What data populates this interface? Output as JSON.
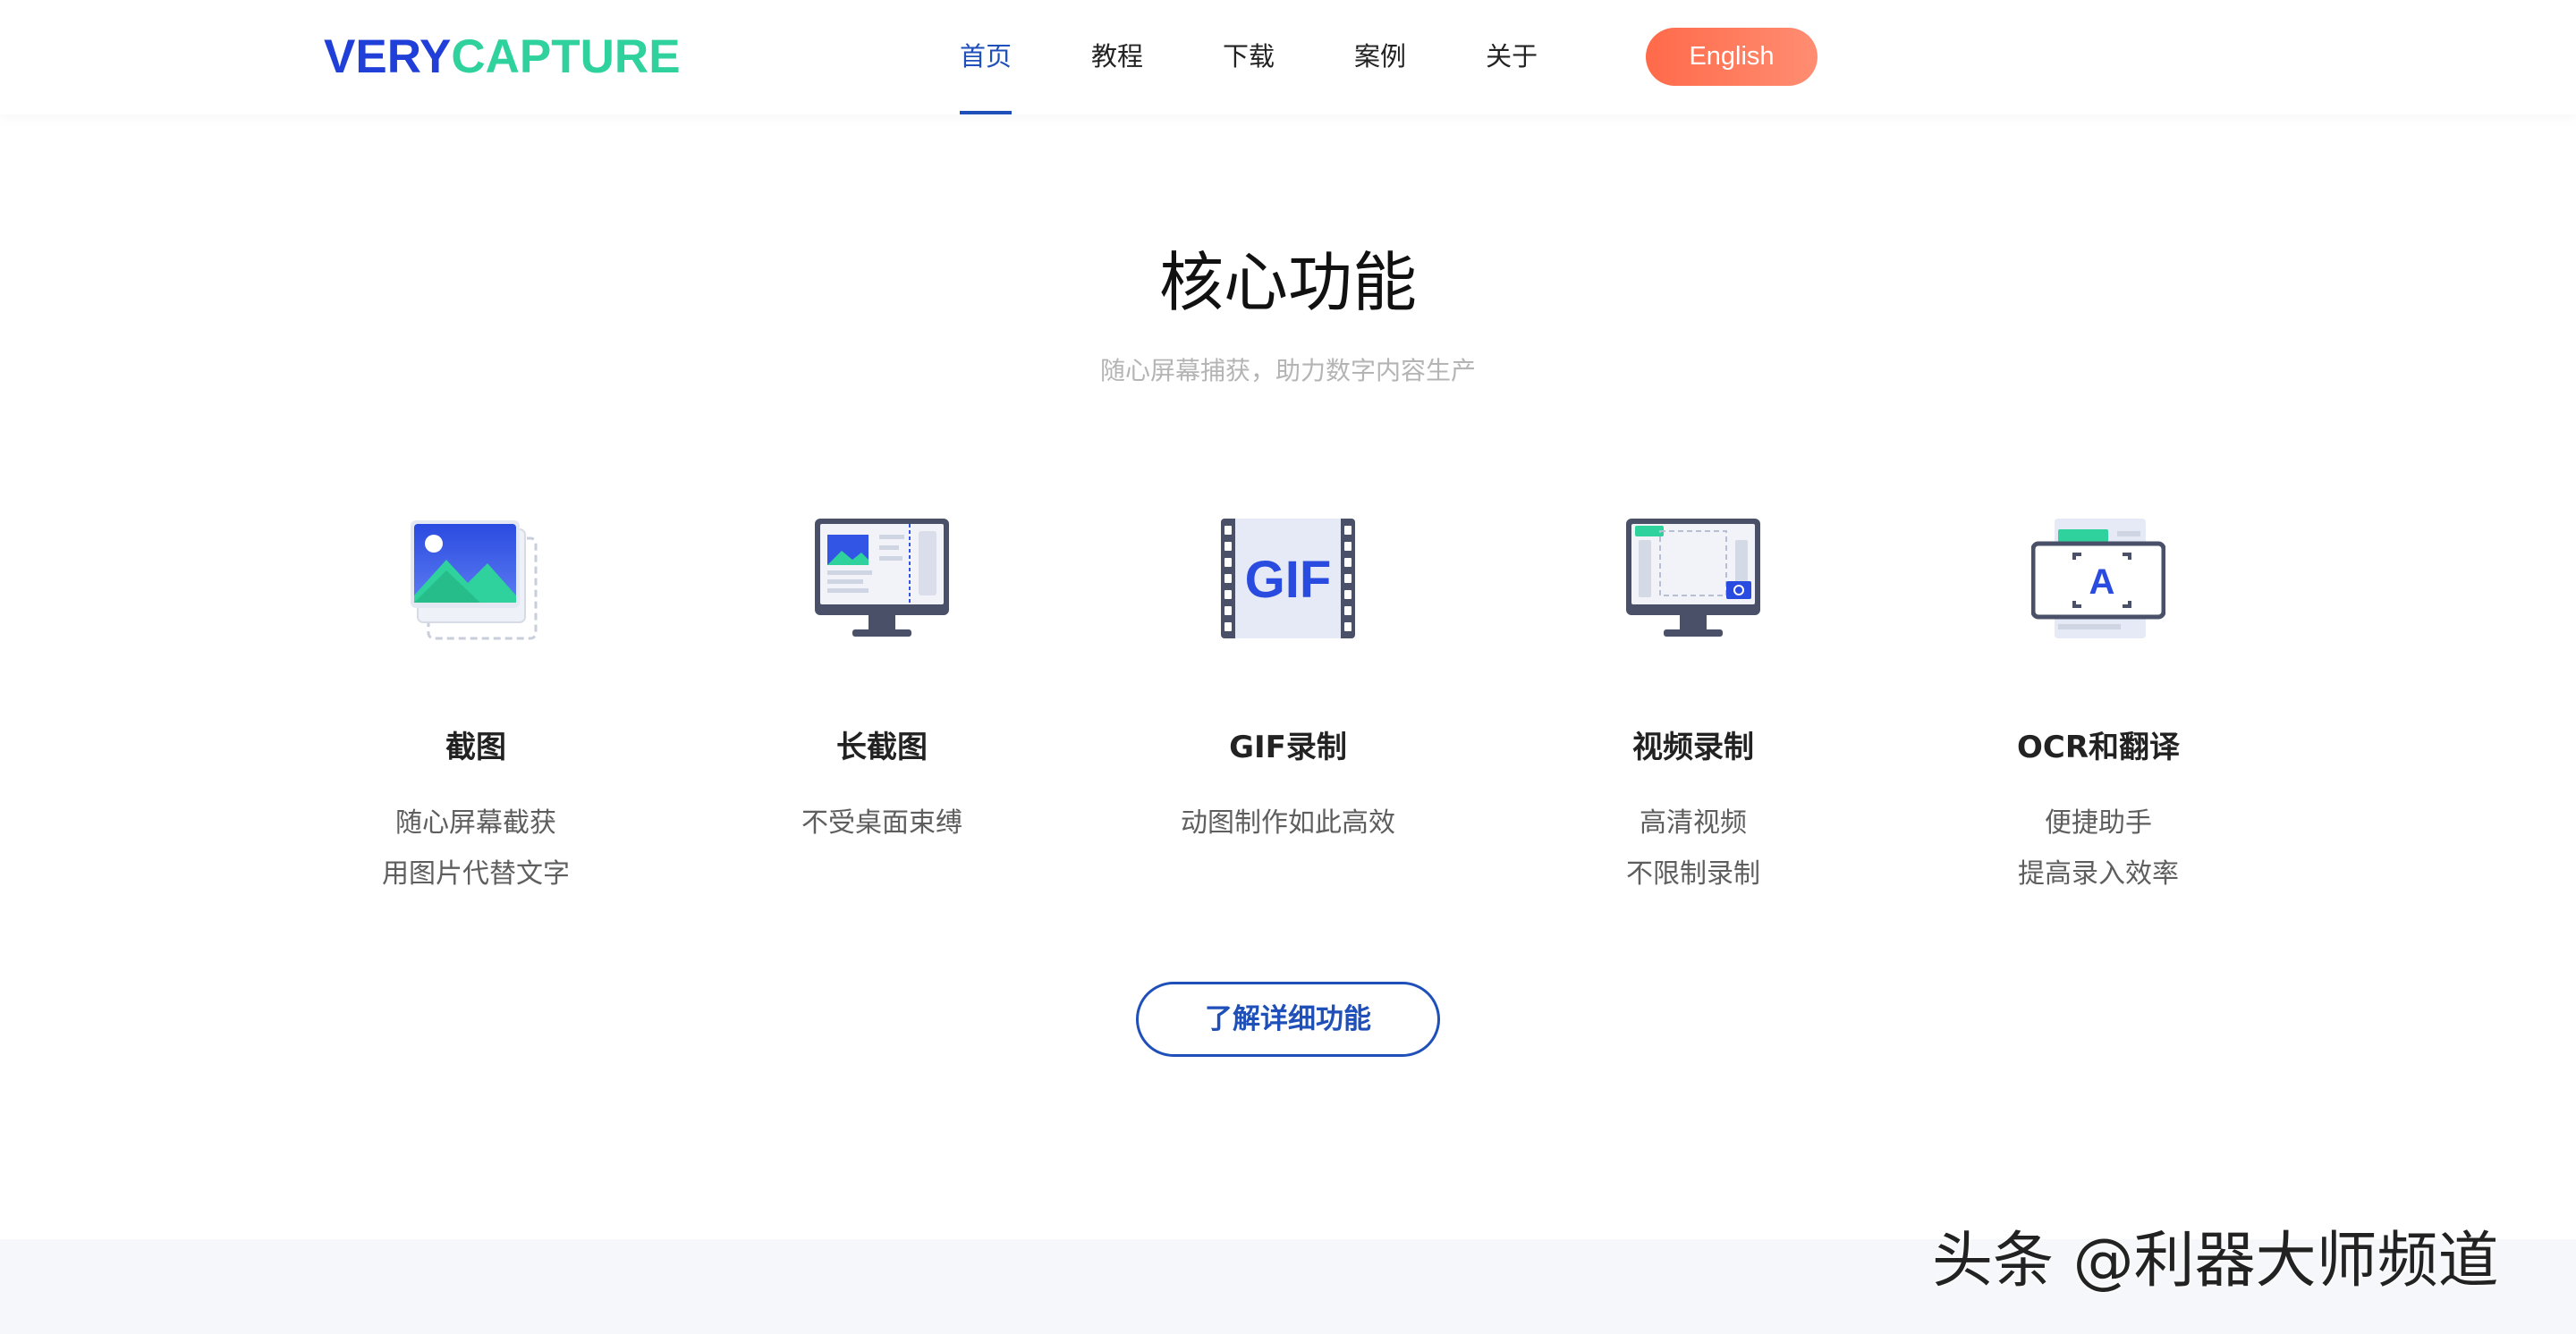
{
  "header": {
    "logo": {
      "part1": "VERY",
      "part2": "CAPTURE"
    },
    "nav": [
      {
        "label": "首页",
        "active": true
      },
      {
        "label": "教程",
        "active": false
      },
      {
        "label": "下载",
        "active": false
      },
      {
        "label": "案例",
        "active": false
      },
      {
        "label": "关于",
        "active": false
      }
    ],
    "language_button": "English"
  },
  "section": {
    "title": "核心功能",
    "subtitle": "随心屏幕捕获，助力数字内容生产"
  },
  "features": [
    {
      "icon": "image-stack-icon",
      "title": "截图",
      "desc_line1": "随心屏幕截获",
      "desc_line2": "用图片代替文字"
    },
    {
      "icon": "monitor-long-screenshot-icon",
      "title": "长截图",
      "desc_line1": "不受桌面束缚",
      "desc_line2": ""
    },
    {
      "icon": "gif-film-icon",
      "title": "GIF录制",
      "desc_line1": "动图制作如此高效",
      "desc_line2": ""
    },
    {
      "icon": "monitor-video-record-icon",
      "title": "视频录制",
      "desc_line1": "高清视频",
      "desc_line2": "不限制录制"
    },
    {
      "icon": "ocr-translate-icon",
      "title": "OCR和翻译",
      "desc_line1": "便捷助手",
      "desc_line2": "提高录入效率"
    }
  ],
  "cta_button": "了解详细功能",
  "watermark": "头条 @利器大师频道",
  "colors": {
    "brand_blue": "#1f3fd8",
    "brand_green": "#2fd29c",
    "nav_active": "#1f4fb8",
    "lang_button": "#ff6a4a"
  }
}
